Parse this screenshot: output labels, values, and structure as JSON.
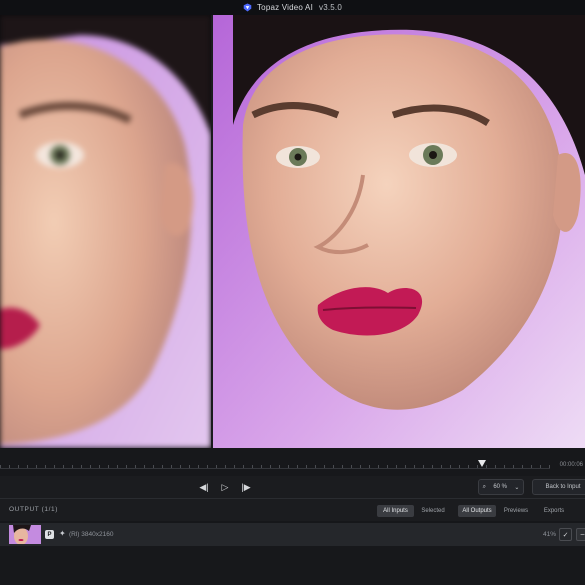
{
  "app": {
    "name": "Topaz Video AI",
    "version": "v3.5.0",
    "accent": "#4f6bff"
  },
  "timeline": {
    "timecode": "00:00:06",
    "playhead_fraction": 0.87
  },
  "transport": {
    "prev_frame_icon": "step-back-icon",
    "play_icon": "play-icon",
    "next_frame_icon": "step-forward-icon",
    "zoom_value": "60",
    "zoom_unit": "%",
    "back_to_input": "Back to Input"
  },
  "output": {
    "title": "OUTPUT (1/1)",
    "filters": [
      "All Inputs",
      "Selected",
      "All Outputs",
      "Previews",
      "Exports"
    ],
    "active_filters": [
      "All Inputs",
      "All Outputs"
    ],
    "row": {
      "badge": "P",
      "model_code": "(Rl)",
      "resolution": "3840x2160",
      "progress": "41%",
      "progress_value": 41
    }
  }
}
